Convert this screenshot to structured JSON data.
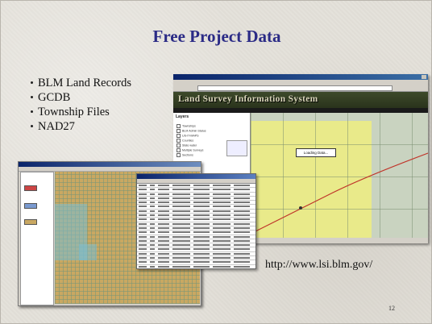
{
  "slide": {
    "title": "Free Project Data",
    "bullets": [
      "BLM Land Records",
      "GCDB",
      "Township Files",
      "NAD27"
    ],
    "url": "http://www.lsi.blm.gov/",
    "page_number": "12"
  },
  "lsis_screenshot": {
    "banner_title": "Land Survey Information System",
    "layers_heading": "Layers",
    "layer_items": [
      "Townships",
      "BLM Admin Status",
      "US-IT-MAPS",
      "Counties",
      "State water",
      "Multiple Surveys",
      "Sections"
    ],
    "map_status": "Loading Data..."
  }
}
